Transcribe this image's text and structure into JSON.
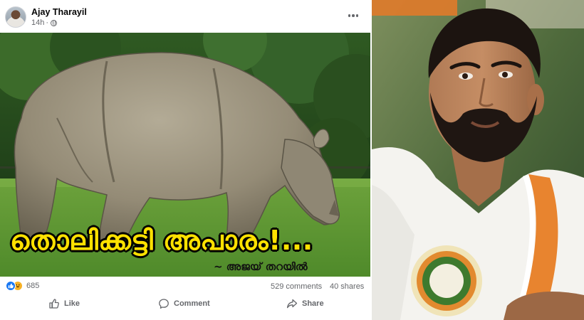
{
  "post": {
    "author": "Ajay Tharayil",
    "time": "14h",
    "visibility_icon": "globe-icon",
    "menu_icon": "more-options-icon",
    "image": {
      "caption": "തൊലിക്കട്ടി അപാരം!...",
      "signature": "~ അജയ് തറയിൽ"
    },
    "stats": {
      "reactions_count": "685",
      "reaction_icons": [
        "like-icon",
        "haha-icon"
      ],
      "comments": "529 comments",
      "shares": "40 shares"
    },
    "actions": {
      "like": "Like",
      "comment": "Comment",
      "share": "Share"
    }
  },
  "colors": {
    "facebook_blue": "#1877f2",
    "caption_yellow": "#ffe100",
    "secondary_text": "#65676b"
  }
}
